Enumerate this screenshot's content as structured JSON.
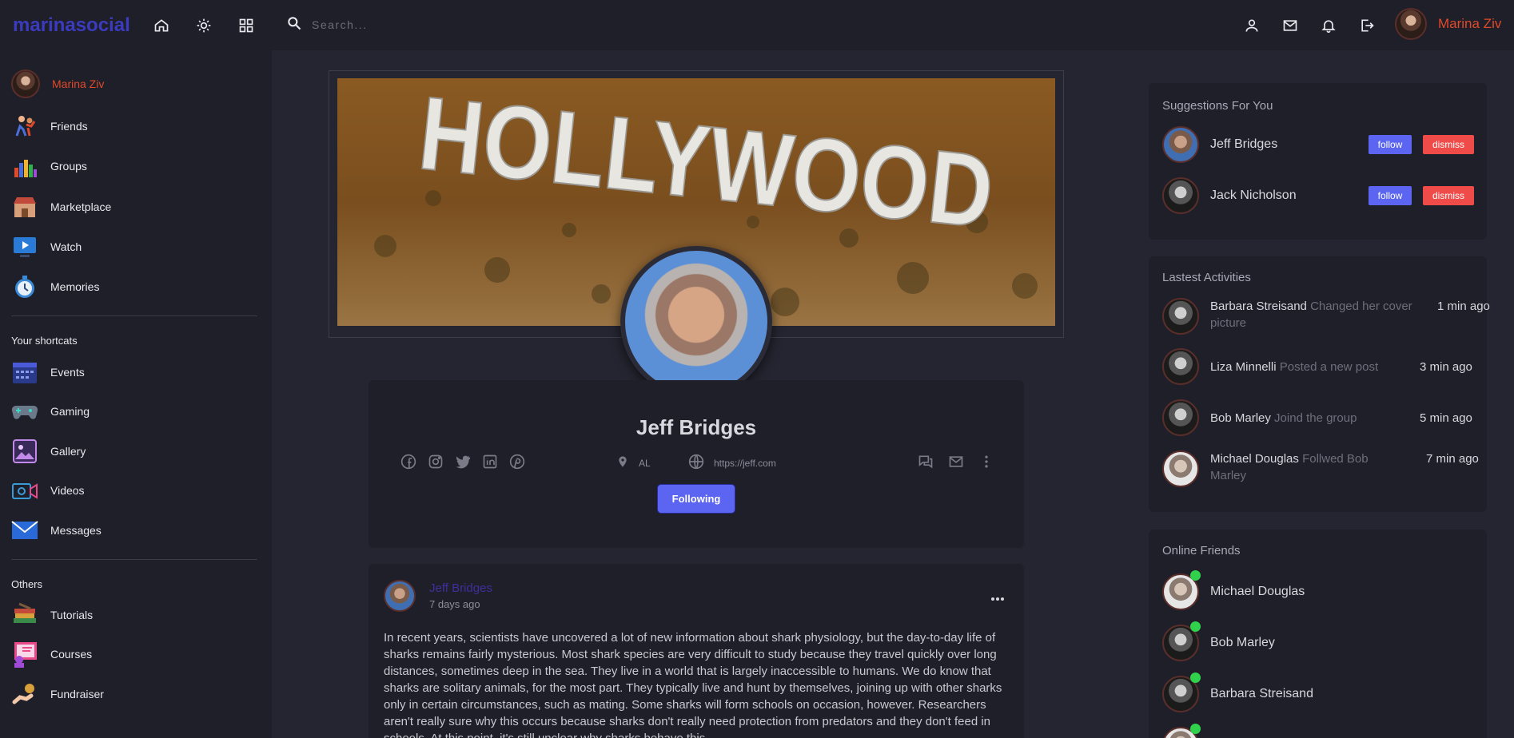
{
  "app": {
    "logo": "marinasocial"
  },
  "search": {
    "placeholder": "Search..."
  },
  "user": {
    "name": "Marina Ziv"
  },
  "sidebar": {
    "main": [
      {
        "label": "Friends",
        "icon": "friends-icon"
      },
      {
        "label": "Groups",
        "icon": "groups-icon"
      },
      {
        "label": "Marketplace",
        "icon": "marketplace-icon"
      },
      {
        "label": "Watch",
        "icon": "watch-icon"
      },
      {
        "label": "Memories",
        "icon": "memories-icon"
      }
    ],
    "shortcuts_heading": "Your shortcats",
    "shortcuts": [
      {
        "label": "Events",
        "icon": "events-icon"
      },
      {
        "label": "Gaming",
        "icon": "gaming-icon"
      },
      {
        "label": "Gallery",
        "icon": "gallery-icon"
      },
      {
        "label": "Videos",
        "icon": "videos-icon"
      },
      {
        "label": "Messages",
        "icon": "messages-icon"
      }
    ],
    "others_heading": "Others",
    "others": [
      {
        "label": "Tutorials",
        "icon": "tutorials-icon"
      },
      {
        "label": "Courses",
        "icon": "courses-icon"
      },
      {
        "label": "Fundraiser",
        "icon": "fundraiser-icon"
      }
    ]
  },
  "cover": {
    "sign_text": "HOLLYWOOD"
  },
  "profile": {
    "name": "Jeff Bridges",
    "location": "AL",
    "website": "https://jeff.com",
    "follow_button": "Following"
  },
  "post": {
    "author": "Jeff Bridges",
    "time": "7 days ago",
    "text": "In recent years, scientists have uncovered a lot of new information about shark physiology, but the day-to-day life of sharks remains fairly mysterious. Most shark species are very difficult to study because they travel quickly over long distances, sometimes deep in the sea. They live in a world that is largely inaccessible to humans. We do know that sharks are solitary animals, for the most part. They typically live and hunt by themselves, joining up with other sharks only in certain circumstances, such as mating. Some sharks will form schools on occasion, however. Researchers aren't really sure why this occurs because sharks don't really need protection from predators and they don't feed in schools. At this point, it's still unclear why sharks behave this"
  },
  "suggestions": {
    "title": "Suggestions For You",
    "follow_label": "follow",
    "dismiss_label": "dismiss",
    "items": [
      {
        "name": "Jeff Bridges"
      },
      {
        "name": "Jack Nicholson"
      }
    ]
  },
  "activities": {
    "title": "Lastest Activities",
    "items": [
      {
        "name": "Barbara Streisand",
        "action": "Changed her cover picture",
        "when": "1 min ago"
      },
      {
        "name": "Liza Minnelli",
        "action": "Posted a new post",
        "when": "3 min ago"
      },
      {
        "name": "Bob Marley",
        "action": "Joind the group",
        "when": "5 min ago"
      },
      {
        "name": "Michael Douglas",
        "action": "Follwed Bob Marley",
        "when": "7 min ago"
      }
    ]
  },
  "online": {
    "title": "Online Friends",
    "items": [
      {
        "name": "Michael Douglas"
      },
      {
        "name": "Bob Marley"
      },
      {
        "name": "Barbara Streisand"
      }
    ]
  }
}
